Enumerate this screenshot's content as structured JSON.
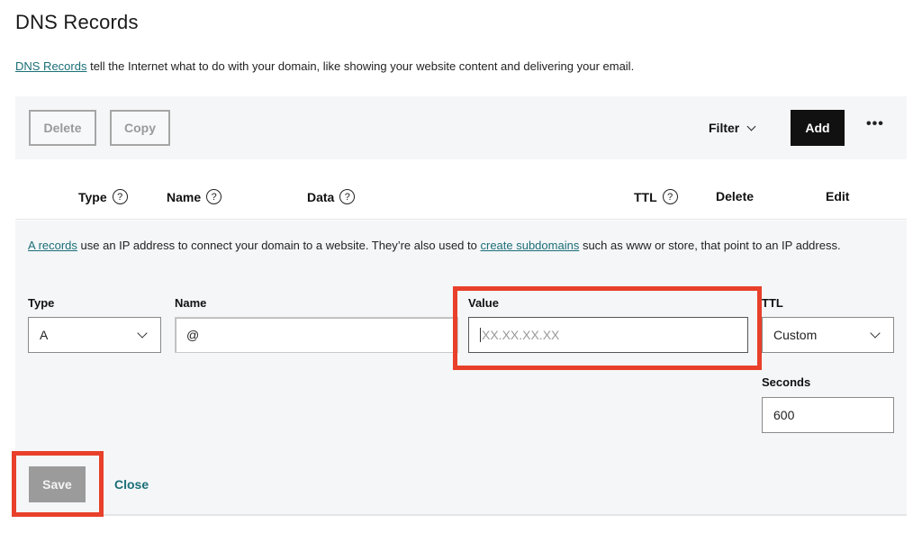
{
  "header": {
    "title": "DNS Records",
    "intro_link": "DNS Records",
    "intro_text": " tell the Internet what to do with your domain, like showing your website content and delivering your email."
  },
  "toolbar": {
    "delete_label": "Delete",
    "copy_label": "Copy",
    "filter_label": "Filter",
    "add_label": "Add",
    "more_label": "•••"
  },
  "table": {
    "columns": [
      {
        "label": "Type",
        "help": true
      },
      {
        "label": "Name",
        "help": true
      },
      {
        "label": "Data",
        "help": true
      },
      {
        "label": "TTL",
        "help": true
      },
      {
        "label": "Delete",
        "help": false
      },
      {
        "label": "Edit",
        "help": false
      }
    ],
    "help_glyph": "?"
  },
  "editor": {
    "info": {
      "link1": "A records",
      "text1": " use an IP address to connect your domain to a website. They’re also used to ",
      "link2": "create subdomains",
      "text2": " such as www or store, that point to an IP address."
    },
    "type": {
      "label": "Type",
      "value": "A"
    },
    "name": {
      "label": "Name",
      "value": "@"
    },
    "value": {
      "label": "Value",
      "placeholder": "XX.XX.XX.XX",
      "value": ""
    },
    "ttl": {
      "label": "TTL",
      "value": "Custom"
    },
    "seconds": {
      "label": "Seconds",
      "value": "600"
    },
    "save_label": "Save",
    "close_label": "Close"
  },
  "colors": {
    "accent_link": "#1b6f77",
    "highlight": "#e8402a",
    "add_button": "#111111",
    "save_disabled": "#9b9b9b",
    "panel_bg": "#f5f6f8"
  }
}
